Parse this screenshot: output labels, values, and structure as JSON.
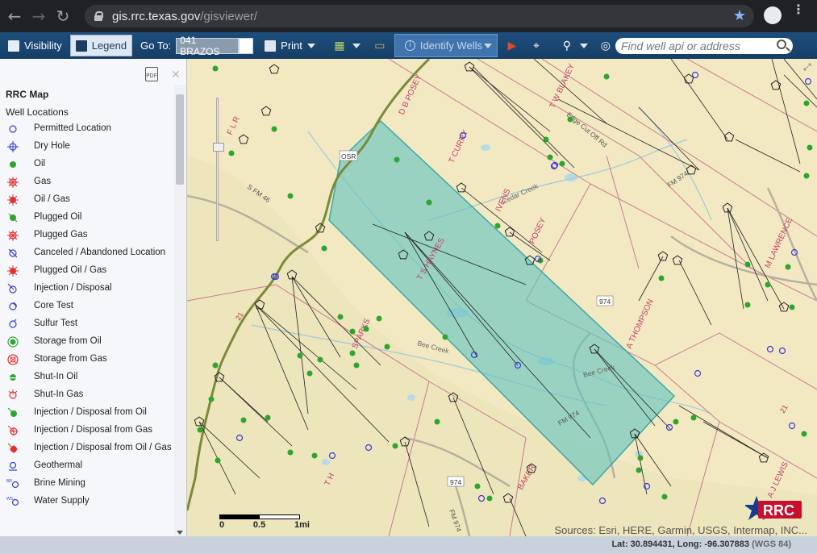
{
  "browser": {
    "url_host": "gis.rrc.texas.gov",
    "url_path": "/gisviewer/"
  },
  "toolbar": {
    "visibility_label": "Visibility",
    "legend_label": "Legend",
    "goto_label": "Go To:",
    "goto_value": "041 BRAZOS",
    "print_label": "Print",
    "identify_label": "Identify Wells",
    "search_placeholder": "Find well api or address"
  },
  "legend": {
    "title": "RRC Map",
    "section": "Well Locations",
    "items": [
      {
        "label": "Permitted Location",
        "icon": "permitted-location-icon"
      },
      {
        "label": "Dry Hole",
        "icon": "dry-hole-icon"
      },
      {
        "label": "Oil",
        "icon": "oil-icon"
      },
      {
        "label": "Gas",
        "icon": "gas-icon"
      },
      {
        "label": "Oil / Gas",
        "icon": "oil-gas-icon"
      },
      {
        "label": "Plugged Oil",
        "icon": "plugged-oil-icon"
      },
      {
        "label": "Plugged Gas",
        "icon": "plugged-gas-icon"
      },
      {
        "label": "Canceled / Abandoned Location",
        "icon": "canceled-location-icon"
      },
      {
        "label": "Plugged Oil / Gas",
        "icon": "plugged-oil-gas-icon"
      },
      {
        "label": "Injection / Disposal",
        "icon": "injection-disposal-icon"
      },
      {
        "label": "Core Test",
        "icon": "core-test-icon"
      },
      {
        "label": "Sulfur Test",
        "icon": "sulfur-test-icon"
      },
      {
        "label": "Storage from Oil",
        "icon": "storage-oil-icon"
      },
      {
        "label": "Storage from Gas",
        "icon": "storage-gas-icon"
      },
      {
        "label": "Shut-In Oil",
        "icon": "shut-in-oil-icon"
      },
      {
        "label": "Shut-In Gas",
        "icon": "shut-in-gas-icon"
      },
      {
        "label": "Injection / Disposal from Oil",
        "icon": "injection-oil-icon"
      },
      {
        "label": "Injection / Disposal from Gas",
        "icon": "injection-gas-icon"
      },
      {
        "label": "Injection / Disposal from Oil / Gas",
        "icon": "injection-oil-gas-icon"
      },
      {
        "label": "Geothermal",
        "icon": "geothermal-icon"
      },
      {
        "label": "Brine Mining",
        "icon": "brine-mining-icon"
      },
      {
        "label": "Water Supply",
        "icon": "water-supply-icon"
      }
    ]
  },
  "map": {
    "labels": {
      "fm_974": "FM 974",
      "fm_46": "S FM 46",
      "road_974": "974",
      "road_osr": "OSR",
      "road_21": "21",
      "bee_creek": "Bee Creek",
      "cedar_creek": "Cedar Creek",
      "edge_cutoff": "Edge Cut Off Rd",
      "survey_curry": "T CURRY",
      "survey_posey": "POSEY",
      "survey_bposey": "D B POSEY",
      "survey_haynes": "T S HAYNES",
      "survey_thompson": "A THOMPSON",
      "survey_sparks": "SPARKS",
      "survey_blakey": "T W BLAKEY",
      "survey_ivens": "IVENS",
      "survey_th": "T H",
      "survey_baker": "BAKER",
      "survey_lawrence": "M LAWRENCE",
      "survey_lewis": "A J LEWIS",
      "survey_flr": "F L R"
    },
    "scale": {
      "zero": "0",
      "half": "0.5",
      "end": "1mi"
    },
    "attribution": "Sources: Esri, HERE, Garmin, USGS, Intermap, INC...",
    "logo_text": "RRC"
  },
  "status": {
    "coords": "Lat: 30.894431, Long: -96.307883",
    "datum": "(WGS 84)"
  },
  "colors": {
    "toolbar": "#1e4e7c",
    "selection": "#5fc3c0",
    "oil_green": "#2ea52e",
    "permit_blue": "#3b3bd6",
    "road_green": "#7a8a3a",
    "survey_red": "#c0406a"
  }
}
